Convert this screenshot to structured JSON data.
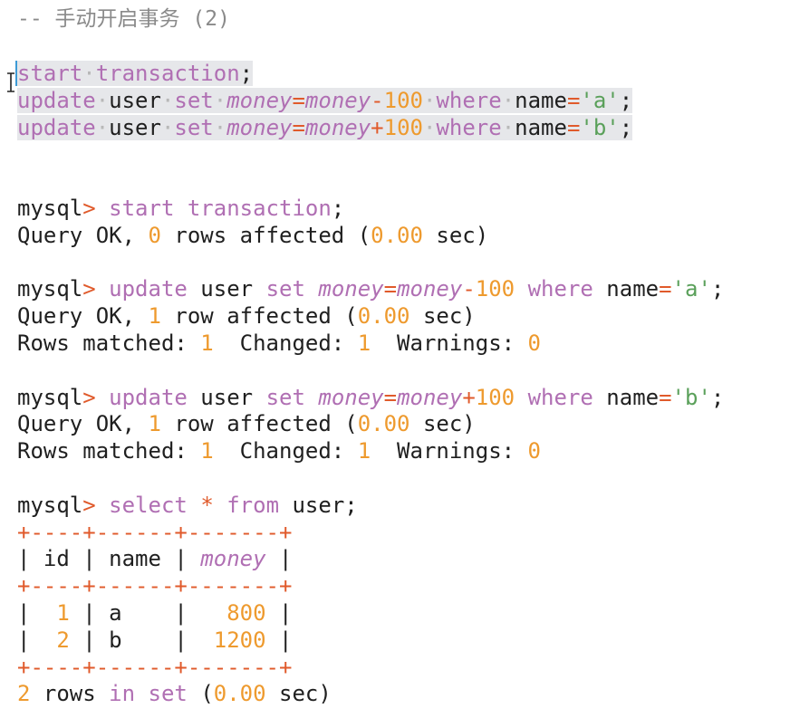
{
  "comment": "-- 手动开启事务 (2)",
  "script_lines": [
    [
      {
        "t": "start",
        "c": "kw"
      },
      {
        "t": "·",
        "c": "dot"
      },
      {
        "t": "transaction",
        "c": "kw"
      },
      {
        "t": ";",
        "c": "plain"
      }
    ],
    [
      {
        "t": "update",
        "c": "kw"
      },
      {
        "t": "·",
        "c": "dot"
      },
      {
        "t": "user",
        "c": "plain"
      },
      {
        "t": "·",
        "c": "dot"
      },
      {
        "t": "set",
        "c": "kw"
      },
      {
        "t": "·",
        "c": "dot"
      },
      {
        "t": "money",
        "c": "fn"
      },
      {
        "t": "=",
        "c": "op"
      },
      {
        "t": "money",
        "c": "fn"
      },
      {
        "t": "-",
        "c": "op"
      },
      {
        "t": "100",
        "c": "num"
      },
      {
        "t": "·",
        "c": "dot"
      },
      {
        "t": "where",
        "c": "kw"
      },
      {
        "t": "·",
        "c": "dot"
      },
      {
        "t": "name",
        "c": "plain"
      },
      {
        "t": "=",
        "c": "op"
      },
      {
        "t": "'a'",
        "c": "str"
      },
      {
        "t": ";",
        "c": "plain"
      }
    ],
    [
      {
        "t": "update",
        "c": "kw"
      },
      {
        "t": "·",
        "c": "dot"
      },
      {
        "t": "user",
        "c": "plain"
      },
      {
        "t": "·",
        "c": "dot"
      },
      {
        "t": "set",
        "c": "kw"
      },
      {
        "t": "·",
        "c": "dot"
      },
      {
        "t": "money",
        "c": "fn"
      },
      {
        "t": "=",
        "c": "op"
      },
      {
        "t": "money",
        "c": "fn"
      },
      {
        "t": "+",
        "c": "op"
      },
      {
        "t": "100",
        "c": "num"
      },
      {
        "t": "·",
        "c": "dot"
      },
      {
        "t": "where",
        "c": "kw"
      },
      {
        "t": "·",
        "c": "dot"
      },
      {
        "t": "name",
        "c": "plain"
      },
      {
        "t": "=",
        "c": "op"
      },
      {
        "t": "'b'",
        "c": "str"
      },
      {
        "t": ";",
        "c": "plain"
      }
    ]
  ],
  "console_lines": [
    [
      {
        "t": "mysql",
        "c": "plain"
      },
      {
        "t": ">",
        "c": "op"
      },
      {
        "t": " start transaction",
        "c": "kw"
      },
      {
        "t": ";",
        "c": "plain"
      }
    ],
    [
      {
        "t": "Query OK, ",
        "c": "plain"
      },
      {
        "t": "0",
        "c": "num"
      },
      {
        "t": " rows affected (",
        "c": "plain"
      },
      {
        "t": "0.00",
        "c": "num"
      },
      {
        "t": " sec)",
        "c": "plain"
      }
    ],
    [],
    [
      {
        "t": "mysql",
        "c": "plain"
      },
      {
        "t": ">",
        "c": "op"
      },
      {
        "t": " update",
        "c": "kw"
      },
      {
        "t": " user ",
        "c": "plain"
      },
      {
        "t": "set",
        "c": "kw"
      },
      {
        "t": " ",
        "c": "plain"
      },
      {
        "t": "money",
        "c": "fn"
      },
      {
        "t": "=",
        "c": "op"
      },
      {
        "t": "money",
        "c": "fn"
      },
      {
        "t": "-",
        "c": "op"
      },
      {
        "t": "100",
        "c": "num"
      },
      {
        "t": " ",
        "c": "plain"
      },
      {
        "t": "where",
        "c": "kw"
      },
      {
        "t": " name",
        "c": "plain"
      },
      {
        "t": "=",
        "c": "op"
      },
      {
        "t": "'a'",
        "c": "str"
      },
      {
        "t": ";",
        "c": "plain"
      }
    ],
    [
      {
        "t": "Query OK, ",
        "c": "plain"
      },
      {
        "t": "1",
        "c": "num"
      },
      {
        "t": " row affected (",
        "c": "plain"
      },
      {
        "t": "0.00",
        "c": "num"
      },
      {
        "t": " sec)",
        "c": "plain"
      }
    ],
    [
      {
        "t": "Rows matched: ",
        "c": "plain"
      },
      {
        "t": "1",
        "c": "num"
      },
      {
        "t": "  Changed: ",
        "c": "plain"
      },
      {
        "t": "1",
        "c": "num"
      },
      {
        "t": "  Warnings: ",
        "c": "plain"
      },
      {
        "t": "0",
        "c": "num"
      }
    ],
    [],
    [
      {
        "t": "mysql",
        "c": "plain"
      },
      {
        "t": ">",
        "c": "op"
      },
      {
        "t": " update",
        "c": "kw"
      },
      {
        "t": " user ",
        "c": "plain"
      },
      {
        "t": "set",
        "c": "kw"
      },
      {
        "t": " ",
        "c": "plain"
      },
      {
        "t": "money",
        "c": "fn"
      },
      {
        "t": "=",
        "c": "op"
      },
      {
        "t": "money",
        "c": "fn"
      },
      {
        "t": "+",
        "c": "op"
      },
      {
        "t": "100",
        "c": "num"
      },
      {
        "t": " ",
        "c": "plain"
      },
      {
        "t": "where",
        "c": "kw"
      },
      {
        "t": " name",
        "c": "plain"
      },
      {
        "t": "=",
        "c": "op"
      },
      {
        "t": "'b'",
        "c": "str"
      },
      {
        "t": ";",
        "c": "plain"
      }
    ],
    [
      {
        "t": "Query OK, ",
        "c": "plain"
      },
      {
        "t": "1",
        "c": "num"
      },
      {
        "t": " row affected (",
        "c": "plain"
      },
      {
        "t": "0.00",
        "c": "num"
      },
      {
        "t": " sec)",
        "c": "plain"
      }
    ],
    [
      {
        "t": "Rows matched: ",
        "c": "plain"
      },
      {
        "t": "1",
        "c": "num"
      },
      {
        "t": "  Changed: ",
        "c": "plain"
      },
      {
        "t": "1",
        "c": "num"
      },
      {
        "t": "  Warnings: ",
        "c": "plain"
      },
      {
        "t": "0",
        "c": "num"
      }
    ],
    [],
    [
      {
        "t": "mysql",
        "c": "plain"
      },
      {
        "t": ">",
        "c": "op"
      },
      {
        "t": " select",
        "c": "kw"
      },
      {
        "t": " ",
        "c": "plain"
      },
      {
        "t": "*",
        "c": "op"
      },
      {
        "t": " ",
        "c": "plain"
      },
      {
        "t": "from",
        "c": "kw"
      },
      {
        "t": " user;",
        "c": "plain"
      }
    ],
    [
      {
        "t": "+",
        "c": "bd"
      },
      {
        "t": "----",
        "c": "bd"
      },
      {
        "t": "+",
        "c": "bd"
      },
      {
        "t": "------",
        "c": "bd"
      },
      {
        "t": "+",
        "c": "bd"
      },
      {
        "t": "-------",
        "c": "bd"
      },
      {
        "t": "+",
        "c": "bd"
      }
    ],
    [
      {
        "t": "| id | name | ",
        "c": "plain"
      },
      {
        "t": "money",
        "c": "fn"
      },
      {
        "t": " |",
        "c": "plain"
      }
    ],
    [
      {
        "t": "+",
        "c": "bd"
      },
      {
        "t": "----",
        "c": "bd"
      },
      {
        "t": "+",
        "c": "bd"
      },
      {
        "t": "------",
        "c": "bd"
      },
      {
        "t": "+",
        "c": "bd"
      },
      {
        "t": "-------",
        "c": "bd"
      },
      {
        "t": "+",
        "c": "bd"
      }
    ],
    [
      {
        "t": "|  ",
        "c": "plain"
      },
      {
        "t": "1",
        "c": "num"
      },
      {
        "t": " | a    |   ",
        "c": "plain"
      },
      {
        "t": "800",
        "c": "num"
      },
      {
        "t": " |",
        "c": "plain"
      }
    ],
    [
      {
        "t": "|  ",
        "c": "plain"
      },
      {
        "t": "2",
        "c": "num"
      },
      {
        "t": " | b    |  ",
        "c": "plain"
      },
      {
        "t": "1200",
        "c": "num"
      },
      {
        "t": " |",
        "c": "plain"
      }
    ],
    [
      {
        "t": "+",
        "c": "bd"
      },
      {
        "t": "----",
        "c": "bd"
      },
      {
        "t": "+",
        "c": "bd"
      },
      {
        "t": "------",
        "c": "bd"
      },
      {
        "t": "+",
        "c": "bd"
      },
      {
        "t": "-------",
        "c": "bd"
      },
      {
        "t": "+",
        "c": "bd"
      }
    ],
    [
      {
        "t": "2",
        "c": "num"
      },
      {
        "t": " rows ",
        "c": "plain"
      },
      {
        "t": "in",
        "c": "kw"
      },
      {
        "t": " ",
        "c": "plain"
      },
      {
        "t": "set",
        "c": "kw"
      },
      {
        "t": " (",
        "c": "plain"
      },
      {
        "t": "0.00",
        "c": "num"
      },
      {
        "t": " sec)",
        "c": "plain"
      }
    ]
  ],
  "colors": {
    "keyword": "#b06fb3",
    "operator": "#e05a2b",
    "number": "#ee9a2e",
    "string": "#5aa05a",
    "selection": "#e6e7ea",
    "comment": "#8a8a8a"
  },
  "icons": {
    "cursor": "text-cursor-icon"
  }
}
